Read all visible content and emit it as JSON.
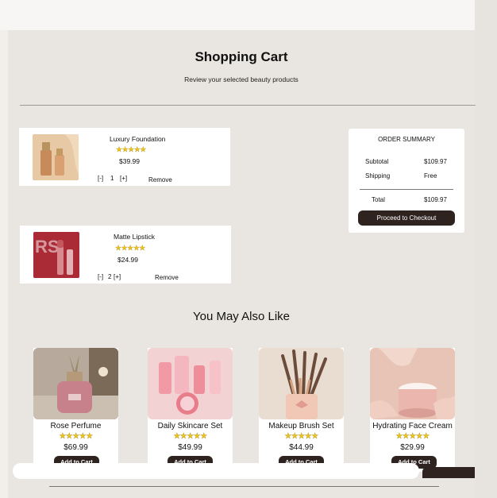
{
  "page": {
    "title": "Shopping Cart",
    "subtitle": "Review your selected beauty products"
  },
  "cart": {
    "items": [
      {
        "name": "Luxury Foundation",
        "stars": "★★★★★",
        "price": "$39.99",
        "decrement": "[-]",
        "quantity": "1",
        "increment": "[+]",
        "remove": "Remove"
      },
      {
        "name": "Matte Lipstick",
        "stars": "★★★★★",
        "price": "$24.99",
        "decrement": "[-]",
        "quantity": "2",
        "increment": "[+]",
        "remove": "Remove"
      }
    ]
  },
  "summary": {
    "title": "ORDER SUMMARY",
    "subtotal_label": "Subtotal",
    "subtotal_value": "$109.97",
    "shipping_label": "Shipping",
    "shipping_value": "Free",
    "total_label": "Total",
    "total_value": "$109.97",
    "checkout_label": "Proceed to Checkout"
  },
  "recommendations": {
    "heading": "You May Also Like",
    "products": [
      {
        "name": "Rose Perfume",
        "stars": "★★★★★",
        "price": "$69.99",
        "button": "Add to Cart"
      },
      {
        "name": "Daily Skincare Set",
        "stars": "★★★★★",
        "price": "$49.99",
        "button": "Add to Cart"
      },
      {
        "name": "Makeup Brush Set",
        "stars": "★★★★★",
        "price": "$44.99",
        "button": "Add to Cart"
      },
      {
        "name": "Hydrating Face Cream",
        "stars": "★★★★★",
        "price": "$29.99",
        "button": "Add to Cart"
      }
    ]
  },
  "colors": {
    "accent_dark": "#2f2320",
    "star": "#f2c318",
    "panel_bg": "#e9e6e1"
  }
}
